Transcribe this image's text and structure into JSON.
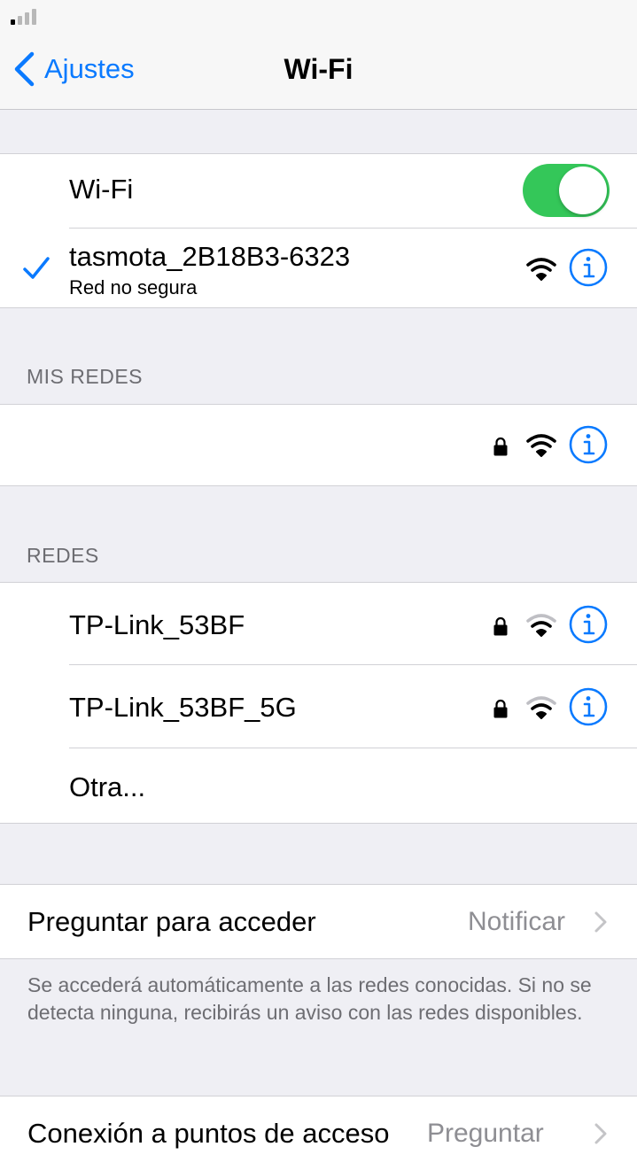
{
  "nav": {
    "back_label": "Ajustes",
    "title": "Wi-Fi"
  },
  "wifi_toggle": {
    "label": "Wi-Fi",
    "on": true
  },
  "connected": {
    "name": "tasmota_2B18B3-6323",
    "subtitle": "Red no segura"
  },
  "sections": {
    "my_networks_header": "MIS REDES",
    "networks_header": "REDES"
  },
  "my_networks": [
    {
      "name": "",
      "locked": true
    }
  ],
  "networks": [
    {
      "name": "TP-Link_53BF",
      "locked": true
    },
    {
      "name": "TP-Link_53BF_5G",
      "locked": true
    }
  ],
  "other_label": "Otra...",
  "ask_to_join": {
    "label": "Preguntar para acceder",
    "value": "Notificar"
  },
  "footer": "Se accederá automáticamente a las redes conocidas. Si no se detecta ninguna, recibirás un aviso con las redes disponibles.",
  "hotspot": {
    "label": "Conexión a puntos de acceso",
    "value": "Preguntar"
  },
  "colors": {
    "accent": "#0a7aff",
    "toggle_on": "#34c759",
    "background": "#efeff4"
  }
}
